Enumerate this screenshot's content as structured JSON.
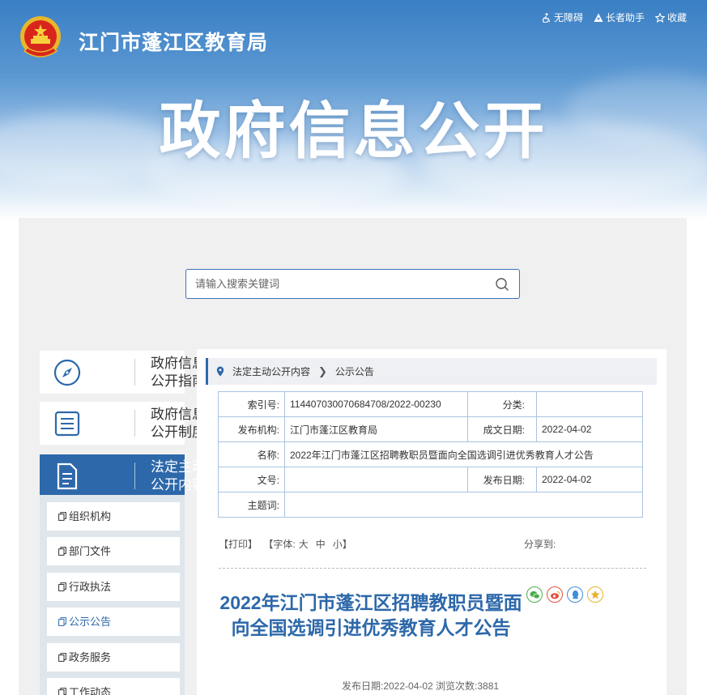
{
  "header": {
    "site_title": "江门市蓬江区教育局",
    "hero_title": "政府信息公开",
    "tools": [
      {
        "label": "无障碍",
        "icon": "accessibility-icon"
      },
      {
        "label": "长者助手",
        "icon": "elder-assist-icon"
      },
      {
        "label": "收藏",
        "icon": "star-icon"
      }
    ]
  },
  "search": {
    "placeholder": "请输入搜索关键词",
    "icon": "search-icon"
  },
  "sidebar": {
    "cards": [
      {
        "label": "政府信息公开指南",
        "icon": "compass-icon"
      },
      {
        "label": "政府信息公开制度",
        "icon": "list-doc-icon"
      },
      {
        "label": "法定主动公开内容",
        "icon": "document-icon",
        "active": true
      }
    ],
    "items": [
      {
        "label": "组织机构"
      },
      {
        "label": "部门文件"
      },
      {
        "label": "行政执法"
      },
      {
        "label": "公示公告",
        "active": true
      },
      {
        "label": "政务服务"
      },
      {
        "label": "工作动态"
      }
    ]
  },
  "breadcrumb": {
    "items": [
      "法定主动公开内容",
      "公示公告"
    ]
  },
  "meta": {
    "index_no_label": "索引号:",
    "index_no": "114407030070684708/2022-00230",
    "category_label": "分类:",
    "category": "",
    "publisher_label": "发布机构:",
    "publisher": "江门市蓬江区教育局",
    "created_label": "成文日期:",
    "created": "2022-04-02",
    "name_label": "名称:",
    "name": "2022年江门市蓬江区招聘教职员暨面向全国选调引进优秀教育人才公告",
    "doc_no_label": "文号:",
    "doc_no": "",
    "published_label": "发布日期:",
    "published": "2022-04-02",
    "subject_label": "主题词:",
    "subject": ""
  },
  "article_tools": {
    "print": "【打印】",
    "font_prefix": "【字体:",
    "font_large": "大",
    "font_medium": "中",
    "font_small": "小",
    "font_suffix": "】",
    "share_label": "分享到:"
  },
  "share_icons": [
    {
      "name": "wechat-icon",
      "color": "#4aae4a"
    },
    {
      "name": "weibo-icon",
      "color": "#e0533f"
    },
    {
      "name": "qq-icon",
      "color": "#3a8fd8"
    },
    {
      "name": "qzone-icon",
      "color": "#e8b22f"
    }
  ],
  "article": {
    "title": "2022年江门市蓬江区招聘教职员暨面向全国选调引进优秀教育人才公告",
    "publish_text": "发布日期:2022-04-02   浏览次数:3881"
  },
  "colors": {
    "brand": "#2d68aa",
    "table_border": "#a9c4df",
    "panel": "#f0f0f0"
  }
}
